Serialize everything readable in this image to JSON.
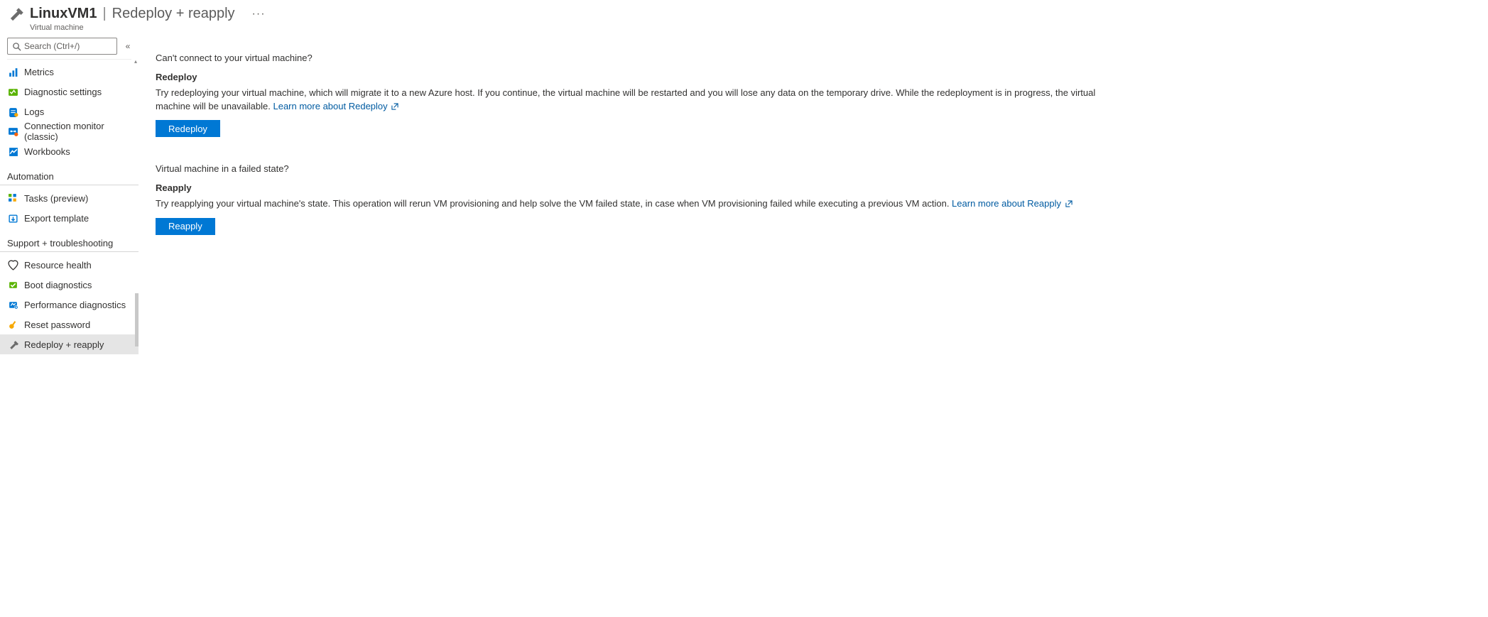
{
  "header": {
    "resource_name": "LinuxVM1",
    "page_title": "Redeploy + reapply",
    "resource_type": "Virtual machine",
    "overflow": "···"
  },
  "search": {
    "placeholder": "Search (Ctrl+/)"
  },
  "nav": {
    "items_top": [
      {
        "label": "Metrics",
        "icon": "metrics"
      },
      {
        "label": "Diagnostic settings",
        "icon": "diagnostic"
      },
      {
        "label": "Logs",
        "icon": "logs"
      },
      {
        "label": "Connection monitor (classic)",
        "icon": "connmon"
      },
      {
        "label": "Workbooks",
        "icon": "workbooks"
      }
    ],
    "section_automation": "Automation",
    "items_automation": [
      {
        "label": "Tasks (preview)",
        "icon": "tasks"
      },
      {
        "label": "Export template",
        "icon": "export"
      }
    ],
    "section_support": "Support + troubleshooting",
    "items_support": [
      {
        "label": "Resource health",
        "icon": "health"
      },
      {
        "label": "Boot diagnostics",
        "icon": "boot"
      },
      {
        "label": "Performance diagnostics",
        "icon": "perf"
      },
      {
        "label": "Reset password",
        "icon": "key"
      },
      {
        "label": "Redeploy + reapply",
        "icon": "hammer",
        "selected": true
      }
    ]
  },
  "content": {
    "q1": "Can't connect to your virtual machine?",
    "s1_title": "Redeploy",
    "s1_desc": "Try redeploying your virtual machine, which will migrate it to a new Azure host. If you continue, the virtual machine will be restarted and you will lose any data on the temporary drive. While the redeployment is in progress, the virtual machine will be unavailable. ",
    "s1_link": "Learn more about Redeploy",
    "s1_btn": "Redeploy",
    "q2": "Virtual machine in a failed state?",
    "s2_title": "Reapply",
    "s2_desc": "Try reapplying your virtual machine's state. This operation will rerun VM provisioning and help solve the VM failed state, in case when VM provisioning failed while executing a previous VM action. ",
    "s2_link": "Learn more about Reapply",
    "s2_btn": "Reapply"
  }
}
